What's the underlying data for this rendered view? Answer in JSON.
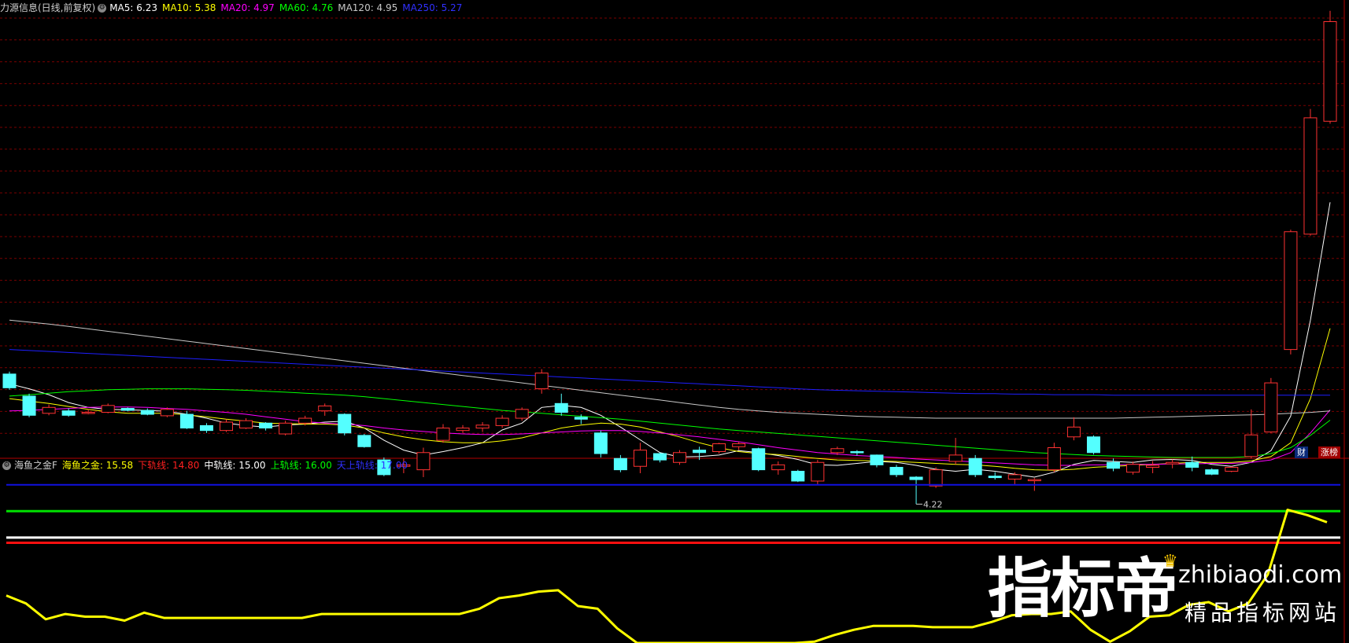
{
  "main_header": {
    "title": "力源信息(日线,前复权)",
    "ma": [
      {
        "label": "MA5: 6.23",
        "color": "#ffffff"
      },
      {
        "label": "MA10: 5.38",
        "color": "#ffff00"
      },
      {
        "label": "MA20: 4.97",
        "color": "#ff00ff"
      },
      {
        "label": "MA60: 4.76",
        "color": "#00ff00"
      },
      {
        "label": "MA120: 4.95",
        "color": "#c8c8c8"
      },
      {
        "label": "MA250: 5.27",
        "color": "#3030ff"
      }
    ]
  },
  "indicator_header": {
    "name": "海鱼之金F",
    "items": [
      {
        "label": "海鱼之金: 15.58",
        "color": "#ffff00"
      },
      {
        "label": "下轨线: 14.80",
        "color": "#ff2020"
      },
      {
        "label": "中轨线: 15.00",
        "color": "#ffffff"
      },
      {
        "label": "上轨线: 16.00",
        "color": "#00ff00"
      },
      {
        "label": "天上轨线: 17.00",
        "color": "#3030ff"
      }
    ]
  },
  "badges": {
    "cai": "财",
    "zhangbang": "涨榜"
  },
  "low_marker": "4.22",
  "watermark": {
    "big": "指标帝",
    "url": "zhibiaodi.com",
    "slogan": "精品指标网站"
  },
  "colors": {
    "up": "#ff3232",
    "down": "#54ffff",
    "grid": "#7a0000",
    "border": "#b40000"
  },
  "chart_data": [
    {
      "type": "candlestick",
      "title": "力源信息(日线,前复权)",
      "ylim": [
        4.0,
        13.0
      ],
      "series": [
        {
          "name": "K",
          "ohlc": [
            [
              5.7,
              5.75,
              5.38,
              5.42
            ],
            [
              5.25,
              5.3,
              4.82,
              4.86
            ],
            [
              4.9,
              5.08,
              4.86,
              5.02
            ],
            [
              4.95,
              5.0,
              4.83,
              4.86
            ],
            [
              4.92,
              4.98,
              4.88,
              4.92
            ],
            [
              4.92,
              5.1,
              4.9,
              5.06
            ],
            [
              5.0,
              5.02,
              4.94,
              4.96
            ],
            [
              4.96,
              5.0,
              4.86,
              4.88
            ],
            [
              4.85,
              5.02,
              4.82,
              4.98
            ],
            [
              4.88,
              4.95,
              4.58,
              4.6
            ],
            [
              4.65,
              4.7,
              4.5,
              4.55
            ],
            [
              4.55,
              4.78,
              4.52,
              4.72
            ],
            [
              4.6,
              4.8,
              4.58,
              4.75
            ],
            [
              4.7,
              4.72,
              4.55,
              4.6
            ],
            [
              4.48,
              4.75,
              4.45,
              4.7
            ],
            [
              4.7,
              4.85,
              4.65,
              4.8
            ],
            [
              4.95,
              5.1,
              4.85,
              5.05
            ],
            [
              4.88,
              4.9,
              4.45,
              4.5
            ],
            [
              4.45,
              4.48,
              4.2,
              4.22
            ],
            [
              3.95,
              4.0,
              3.62,
              3.65
            ],
            [
              3.82,
              3.98,
              3.68,
              3.85
            ],
            [
              3.75,
              4.2,
              3.6,
              4.1
            ],
            [
              4.35,
              4.68,
              4.3,
              4.6
            ],
            [
              4.55,
              4.66,
              4.5,
              4.6
            ],
            [
              4.6,
              4.72,
              4.52,
              4.66
            ],
            [
              4.65,
              4.86,
              4.6,
              4.8
            ],
            [
              4.8,
              5.02,
              4.75,
              4.98
            ],
            [
              5.4,
              5.8,
              5.3,
              5.72
            ],
            [
              5.1,
              5.3,
              4.85,
              4.92
            ],
            [
              4.82,
              4.88,
              4.68,
              4.78
            ],
            [
              4.5,
              4.55,
              4.0,
              4.08
            ],
            [
              3.98,
              4.05,
              3.7,
              3.75
            ],
            [
              3.82,
              4.3,
              3.68,
              4.15
            ],
            [
              4.08,
              4.1,
              3.9,
              3.95
            ],
            [
              3.9,
              4.15,
              3.85,
              4.1
            ],
            [
              4.15,
              4.22,
              3.95,
              4.1
            ],
            [
              4.12,
              4.3,
              4.08,
              4.28
            ],
            [
              4.22,
              4.32,
              4.15,
              4.28
            ],
            [
              4.18,
              4.2,
              3.72,
              3.75
            ],
            [
              3.75,
              3.92,
              3.65,
              3.85
            ],
            [
              3.72,
              3.75,
              3.5,
              3.52
            ],
            [
              3.52,
              3.95,
              3.45,
              3.9
            ],
            [
              4.1,
              4.22,
              4.05,
              4.18
            ],
            [
              4.12,
              4.15,
              4.04,
              4.1
            ],
            [
              4.05,
              4.06,
              3.8,
              3.85
            ],
            [
              3.8,
              3.85,
              3.6,
              3.65
            ],
            [
              3.6,
              3.62,
              3.05,
              3.55
            ],
            [
              3.42,
              3.8,
              3.38,
              3.75
            ],
            [
              3.92,
              4.4,
              3.86,
              4.05
            ],
            [
              3.98,
              4.05,
              3.6,
              3.65
            ],
            [
              3.62,
              3.7,
              3.55,
              3.59
            ],
            [
              3.56,
              3.7,
              3.45,
              3.65
            ],
            [
              3.54,
              3.58,
              3.32,
              3.55
            ],
            [
              3.75,
              4.3,
              3.7,
              4.2
            ],
            [
              4.42,
              4.82,
              4.35,
              4.62
            ],
            [
              4.42,
              4.45,
              4.06,
              4.1
            ],
            [
              3.9,
              3.98,
              3.72,
              3.78
            ],
            [
              3.7,
              3.92,
              3.65,
              3.86
            ],
            [
              3.8,
              3.93,
              3.68,
              3.84
            ],
            [
              3.87,
              3.96,
              3.78,
              3.9
            ],
            [
              3.9,
              4.02,
              3.72,
              3.8
            ],
            [
              3.75,
              3.78,
              3.64,
              3.66
            ],
            [
              3.72,
              3.82,
              3.7,
              3.8
            ],
            [
              4.02,
              4.98,
              3.98,
              4.46
            ],
            [
              4.52,
              5.62,
              4.5,
              5.52
            ],
            [
              6.2,
              8.64,
              6.1,
              8.6
            ],
            [
              8.55,
              11.1,
              8.52,
              10.92
            ],
            [
              10.85,
              13.1,
              10.8,
              12.88
            ]
          ]
        },
        {
          "name": "MA5",
          "values": [
            5.5,
            5.4,
            5.28,
            5.12,
            5.02,
            4.98,
            4.97,
            4.96,
            4.94,
            4.88,
            4.8,
            4.7,
            4.65,
            4.62,
            4.66,
            4.68,
            4.72,
            4.74,
            4.6,
            4.35,
            4.15,
            4.05,
            4.12,
            4.2,
            4.3,
            4.56,
            4.7,
            5.02,
            5.06,
            5.02,
            4.86,
            4.62,
            4.36,
            4.1,
            4.01,
            4.02,
            4.05,
            4.14,
            4.1,
            4.04,
            3.96,
            3.85,
            3.84,
            3.88,
            3.92,
            3.9,
            3.84,
            3.76,
            3.72,
            3.76,
            3.72,
            3.66,
            3.6,
            3.7,
            3.86,
            3.94,
            3.92,
            3.9,
            3.95,
            3.96,
            3.94,
            3.86,
            3.82,
            3.9,
            4.14,
            4.84,
            6.8,
            9.2
          ]
        },
        {
          "name": "MA10",
          "values": [
            5.2,
            5.15,
            5.1,
            5.04,
            4.98,
            4.93,
            4.9,
            4.9,
            4.9,
            4.87,
            4.83,
            4.78,
            4.74,
            4.7,
            4.69,
            4.68,
            4.68,
            4.66,
            4.6,
            4.5,
            4.42,
            4.36,
            4.32,
            4.3,
            4.3,
            4.34,
            4.4,
            4.5,
            4.6,
            4.66,
            4.7,
            4.68,
            4.62,
            4.52,
            4.42,
            4.3,
            4.2,
            4.12,
            4.08,
            4.06,
            4.02,
            3.98,
            3.95,
            3.94,
            3.93,
            3.92,
            3.9,
            3.88,
            3.86,
            3.85,
            3.82,
            3.78,
            3.75,
            3.74,
            3.76,
            3.8,
            3.82,
            3.84,
            3.86,
            3.88,
            3.9,
            3.9,
            3.9,
            3.93,
            4.02,
            4.3,
            5.2,
            6.63
          ]
        },
        {
          "name": "MA20",
          "values": [
            4.95,
            4.96,
            4.98,
            5.0,
            5.02,
            5.03,
            5.03,
            5.02,
            5.0,
            4.98,
            4.95,
            4.92,
            4.88,
            4.83,
            4.78,
            4.73,
            4.7,
            4.68,
            4.65,
            4.6,
            4.56,
            4.53,
            4.5,
            4.48,
            4.47,
            4.47,
            4.48,
            4.5,
            4.52,
            4.54,
            4.55,
            4.55,
            4.53,
            4.5,
            4.46,
            4.42,
            4.37,
            4.32,
            4.26,
            4.2,
            4.15,
            4.1,
            4.07,
            4.04,
            4.02,
            4.0,
            3.97,
            3.95,
            3.93,
            3.91,
            3.89,
            3.87,
            3.85,
            3.84,
            3.84,
            3.85,
            3.85,
            3.86,
            3.86,
            3.87,
            3.87,
            3.88,
            3.88,
            3.9,
            3.95,
            4.1,
            4.5,
            4.97
          ]
        },
        {
          "name": "MA60",
          "values": [
            5.25,
            5.28,
            5.31,
            5.34,
            5.36,
            5.38,
            5.39,
            5.4,
            5.4,
            5.4,
            5.39,
            5.38,
            5.37,
            5.35,
            5.33,
            5.31,
            5.29,
            5.27,
            5.24,
            5.2,
            5.16,
            5.12,
            5.08,
            5.04,
            5.0,
            4.96,
            4.93,
            4.9,
            4.87,
            4.84,
            4.81,
            4.78,
            4.74,
            4.7,
            4.66,
            4.62,
            4.58,
            4.55,
            4.52,
            4.49,
            4.46,
            4.43,
            4.4,
            4.37,
            4.34,
            4.31,
            4.28,
            4.25,
            4.22,
            4.19,
            4.16,
            4.13,
            4.1,
            4.08,
            4.06,
            4.04,
            4.03,
            4.02,
            4.01,
            4.0,
            4.0,
            4.0,
            4.0,
            4.02,
            4.08,
            4.2,
            4.45,
            4.76
          ]
        },
        {
          "name": "MA120",
          "values": [
            6.8,
            6.76,
            6.72,
            6.67,
            6.62,
            6.57,
            6.52,
            6.47,
            6.42,
            6.37,
            6.32,
            6.27,
            6.22,
            6.17,
            6.12,
            6.07,
            6.02,
            5.97,
            5.92,
            5.87,
            5.82,
            5.77,
            5.72,
            5.67,
            5.62,
            5.57,
            5.52,
            5.47,
            5.42,
            5.37,
            5.32,
            5.27,
            5.22,
            5.17,
            5.12,
            5.07,
            5.02,
            4.98,
            4.95,
            4.92,
            4.9,
            4.88,
            4.86,
            4.84,
            4.83,
            4.82,
            4.81,
            4.8,
            4.8,
            4.8,
            4.8,
            4.8,
            4.8,
            4.8,
            4.8,
            4.8,
            4.8,
            4.81,
            4.82,
            4.83,
            4.84,
            4.85,
            4.86,
            4.87,
            4.88,
            4.9,
            4.92,
            4.95
          ]
        },
        {
          "name": "MA250",
          "values": [
            6.2,
            6.18,
            6.16,
            6.14,
            6.12,
            6.1,
            6.08,
            6.06,
            6.04,
            6.02,
            6.0,
            5.98,
            5.96,
            5.94,
            5.92,
            5.9,
            5.88,
            5.86,
            5.84,
            5.82,
            5.8,
            5.78,
            5.76,
            5.74,
            5.72,
            5.7,
            5.68,
            5.66,
            5.64,
            5.62,
            5.6,
            5.58,
            5.56,
            5.54,
            5.52,
            5.5,
            5.48,
            5.46,
            5.44,
            5.42,
            5.4,
            5.38,
            5.37,
            5.36,
            5.35,
            5.34,
            5.33,
            5.32,
            5.31,
            5.3,
            5.3,
            5.29,
            5.29,
            5.28,
            5.28,
            5.28,
            5.27,
            5.27,
            5.27,
            5.27,
            5.27,
            5.27,
            5.27,
            5.27,
            5.27,
            5.27,
            5.27,
            5.27
          ]
        }
      ]
    },
    {
      "type": "line",
      "title": "海鱼之金F",
      "ylim": [
        11.0,
        17.5
      ],
      "series": [
        {
          "name": "海鱼之金",
          "values": [
            12.8,
            12.5,
            11.9,
            12.1,
            12.0,
            12.0,
            11.85,
            12.15,
            11.95,
            11.95,
            11.95,
            11.95,
            11.95,
            11.95,
            11.95,
            11.95,
            12.1,
            12.1,
            12.1,
            12.1,
            12.1,
            12.1,
            12.1,
            12.1,
            12.3,
            12.7,
            12.8,
            12.95,
            13.0,
            12.4,
            12.3,
            11.55,
            11.0,
            11.0,
            11.0,
            11.0,
            11.0,
            11.0,
            11.0,
            11.0,
            11.0,
            11.05,
            11.3,
            11.5,
            11.65,
            11.65,
            11.65,
            11.6,
            11.6,
            11.6,
            11.8,
            12.05,
            12.1,
            12.1,
            12.2,
            11.5,
            11.05,
            11.45,
            12.0,
            12.05,
            12.45,
            12.55,
            12.2,
            12.5,
            13.6,
            16.05,
            15.85,
            15.58
          ]
        },
        {
          "name": "天上轨线",
          "values": [
            17.0
          ]
        },
        {
          "name": "上轨线",
          "values": [
            16.0
          ]
        },
        {
          "name": "中轨线",
          "values": [
            15.0
          ]
        },
        {
          "name": "下轨线",
          "values": [
            14.8
          ]
        }
      ]
    }
  ]
}
